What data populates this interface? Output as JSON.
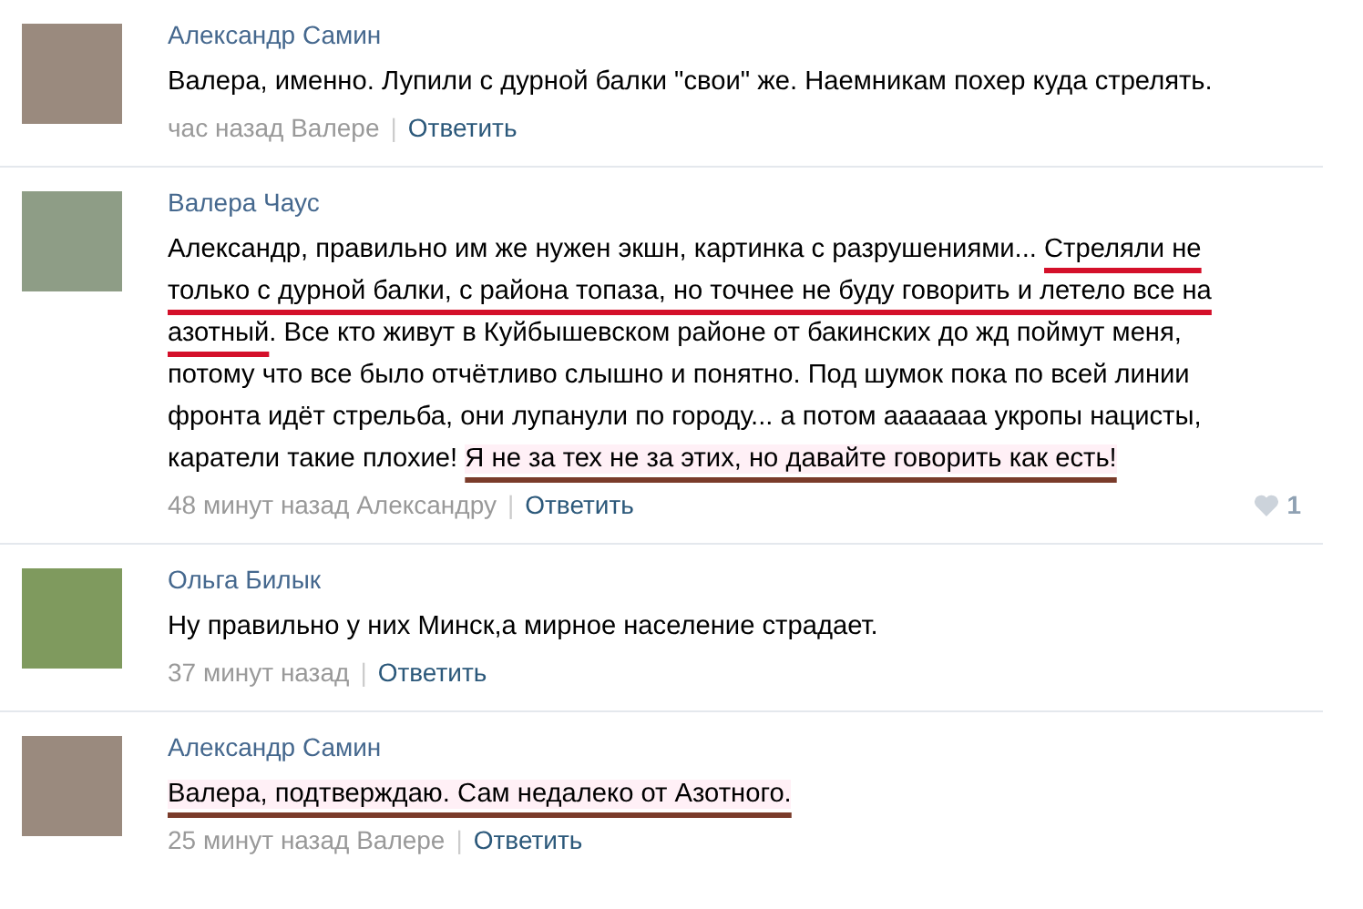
{
  "comments": [
    {
      "author": "Александр Самин",
      "segments": [
        {
          "text": "Валера, именно. Лупили с дурной балки \"свои\" же. Наемникам похер куда стрелять.",
          "kind": "plain"
        }
      ],
      "time": "час назад Валере",
      "separator": "|",
      "reply": "Ответить"
    },
    {
      "author": "Валера Чаус",
      "segments": [
        {
          "text": "Александр, правильно им же нужен экшн, картинка с разрушениями... ",
          "kind": "plain"
        },
        {
          "text": "Стреляли не только с дурной балки, с района топаза, но точнее не буду говорить и летело все на азотный",
          "kind": "red-mark"
        },
        {
          "text": ". Все кто живут в Куйбышевском районе от бакинских до жд поймут меня, потому что все было отчётливо слышно и понятно. Под шумок пока по всей линии фронта идёт стрельба, они лупанули по городу... а потом ааааааа укропы нацисты, каратели такие плохие! ",
          "kind": "plain"
        },
        {
          "text": "Я не за тех не за этих, но давайте говорить как есть!",
          "kind": "brown-mark"
        }
      ],
      "time": "48 минут назад Александру",
      "separator": "|",
      "reply": "Ответить",
      "likes": "1"
    },
    {
      "author": "Ольга Билык",
      "segments": [
        {
          "text": "Ну правильно у них Минск,а мирное население страдает.",
          "kind": "plain"
        }
      ],
      "time": "37 минут назад",
      "separator": "|",
      "reply": "Ответить"
    },
    {
      "author": "Александр Самин",
      "segments": [
        {
          "text": "Валера, подтверждаю. Сам недалеко от Азотного.",
          "kind": "brown-mark"
        }
      ],
      "time": "25 минут назад Валере",
      "separator": "|",
      "reply": "Ответить"
    }
  ]
}
